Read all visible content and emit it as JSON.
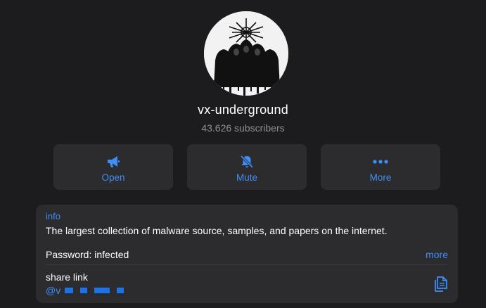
{
  "channel": {
    "avatar_icon": "channel-avatar-image",
    "name": "vx-underground",
    "subscribers": "43.626 subscribers"
  },
  "actions": [
    {
      "label": "Open",
      "icon": "megaphone-icon"
    },
    {
      "label": "Mute",
      "icon": "bell-slash-icon"
    },
    {
      "label": "More",
      "icon": "ellipsis-icon"
    }
  ],
  "info": {
    "title": "info",
    "description": "The largest collection of malware source, samples, and papers on the internet.",
    "password": "Password: infected",
    "more_label": "more",
    "share_label": "share link",
    "share_handle": "@v",
    "copy_icon": "copy-icon"
  },
  "colors": {
    "background": "#1c1c1e",
    "card": "#2c2c2e",
    "accent": "#3e8ef7",
    "secondary_text": "#8e8e93"
  }
}
